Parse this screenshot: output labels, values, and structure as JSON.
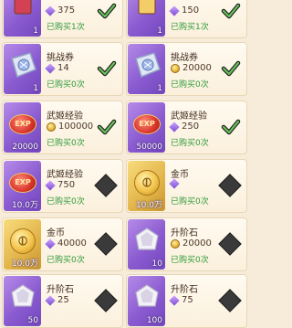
{
  "cards": [
    {
      "name": "",
      "cost": "375",
      "cost_icon": "gem-icon",
      "status": "已购买1次",
      "qty": "1",
      "thumb": "book-red",
      "state": "done"
    },
    {
      "name": "",
      "cost": "150",
      "cost_icon": "gem-icon",
      "status": "已购买1次",
      "qty": "1",
      "thumb": "book-gold",
      "state": "done"
    },
    {
      "name": "挑战券",
      "cost": "14",
      "cost_icon": "gem-icon",
      "status": "已购买0次",
      "qty": "1",
      "thumb": "ticket",
      "state": "done"
    },
    {
      "name": "挑战券",
      "cost": "20000",
      "cost_icon": "coin-icon",
      "status": "已购买0次",
      "qty": "1",
      "thumb": "ticket",
      "state": "done"
    },
    {
      "name": "武姬经验",
      "cost": "100000",
      "cost_icon": "coin-icon",
      "status": "已购买0次",
      "qty": "20000",
      "thumb": "exp",
      "state": "done"
    },
    {
      "name": "武姬经验",
      "cost": "250",
      "cost_icon": "gem-icon",
      "status": "已购买0次",
      "qty": "50000",
      "thumb": "exp",
      "state": "done"
    },
    {
      "name": "武姬经验",
      "cost": "750",
      "cost_icon": "gem-icon",
      "status": "已购买0次",
      "qty": "10.0万",
      "thumb": "exp",
      "state": "locked"
    },
    {
      "name": "金币",
      "cost": "",
      "cost_icon": "gem-icon",
      "status": "已购买0次",
      "qty": "10.0万",
      "thumb": "coin",
      "state": "locked"
    },
    {
      "name": "金币",
      "cost": "40000",
      "cost_icon": "gem-icon",
      "status": "已购买0次",
      "qty": "10.0万",
      "thumb": "coin",
      "state": "locked"
    },
    {
      "name": "升阶石",
      "cost": "20000",
      "cost_icon": "coin-icon",
      "status": "已购买0次",
      "qty": "10",
      "thumb": "stone",
      "state": "locked"
    },
    {
      "name": "升阶石",
      "cost": "25",
      "cost_icon": "gem-icon",
      "status": "",
      "qty": "50",
      "thumb": "stone",
      "state": "locked"
    },
    {
      "name": "升阶石",
      "cost": "75",
      "cost_icon": "gem-icon",
      "status": "",
      "qty": "100",
      "thumb": "stone",
      "state": "locked"
    }
  ],
  "colors": {
    "accent_green": "#2f9a3a",
    "gem_purple": "#8a5bd0",
    "gold": "#e1b44a"
  }
}
